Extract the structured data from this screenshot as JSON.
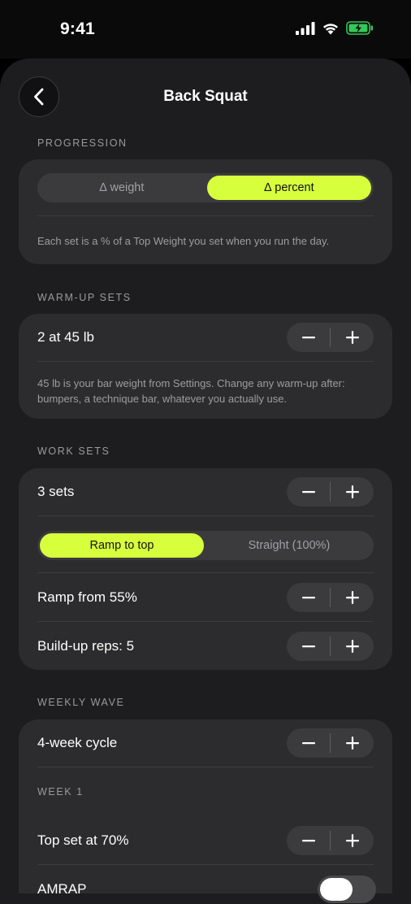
{
  "status_bar": {
    "time": "9:41"
  },
  "header": {
    "title": "Back Squat"
  },
  "progression": {
    "section_label": "PROGRESSION",
    "options": [
      {
        "label": "∆ weight",
        "selected": false
      },
      {
        "label": "∆ percent",
        "selected": true
      }
    ],
    "note": "Each set is a % of a Top Weight you set when you run the day."
  },
  "warmup": {
    "section_label": "WARM-UP SETS",
    "value": "2 at 45 lb",
    "note": "45 lb is your bar weight from Settings. Change any warm-up after: bumpers, a technique bar, whatever you actually use."
  },
  "work_sets": {
    "section_label": "WORK SETS",
    "sets": "3 sets",
    "modes": [
      {
        "label": "Ramp to top",
        "selected": true
      },
      {
        "label": "Straight (100%)",
        "selected": false
      }
    ],
    "ramp_from": "Ramp from 55%",
    "build_up_reps": "Build-up reps: 5"
  },
  "weekly_wave": {
    "section_label": "WEEKLY WAVE",
    "cycle": "4-week cycle",
    "week_label": "WEEK 1",
    "top_set": "Top set at 70%",
    "amrap_label": "AMRAP",
    "amrap_on": false
  },
  "colors": {
    "accent": "#d8ff3c",
    "background": "#000000",
    "sheet": "#1d1d1f",
    "card": "#2c2c2e",
    "control": "#3b3b3e",
    "battery": "#34c759"
  },
  "icons": {
    "back": "chevron-left-icon",
    "minus": "minus-icon",
    "plus": "plus-icon",
    "signal": "cellular-signal-icon",
    "wifi": "wifi-icon",
    "battery": "battery-charging-icon"
  }
}
